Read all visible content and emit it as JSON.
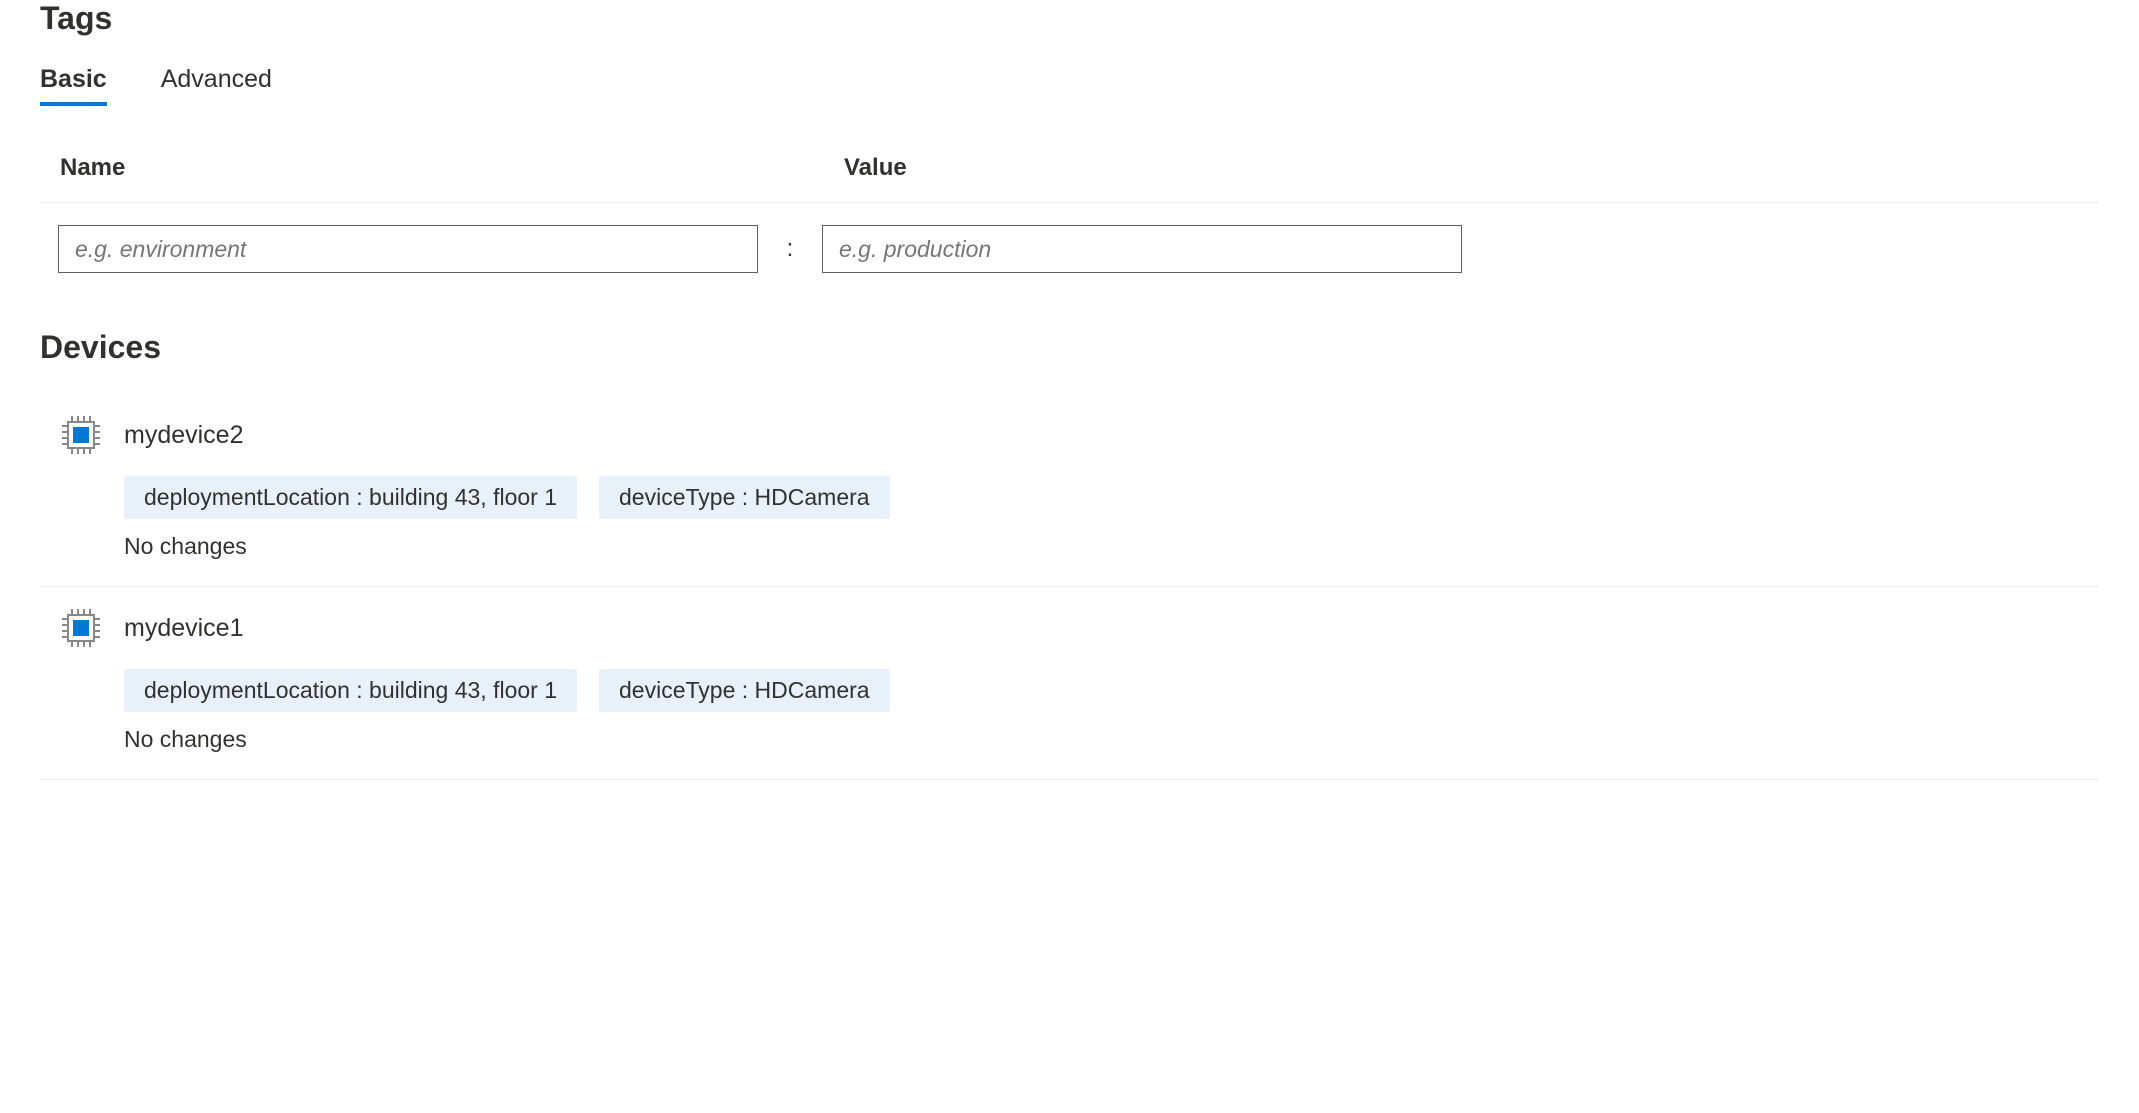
{
  "headings": {
    "tags": "Tags",
    "devices": "Devices"
  },
  "tabs": [
    {
      "label": "Basic",
      "active": true
    },
    {
      "label": "Advanced",
      "active": false
    }
  ],
  "columns": {
    "name": "Name",
    "value": "Value"
  },
  "inputs": {
    "name_placeholder": "e.g. environment",
    "value_placeholder": "e.g. production",
    "separator": ":"
  },
  "devices": [
    {
      "name": "mydevice2",
      "tags": [
        {
          "text": "deploymentLocation : building 43, floor 1"
        },
        {
          "text": "deviceType : HDCamera"
        }
      ],
      "status": "No changes"
    },
    {
      "name": "mydevice1",
      "tags": [
        {
          "text": "deploymentLocation : building 43, floor 1"
        },
        {
          "text": "deviceType : HDCamera"
        }
      ],
      "status": "No changes"
    }
  ]
}
